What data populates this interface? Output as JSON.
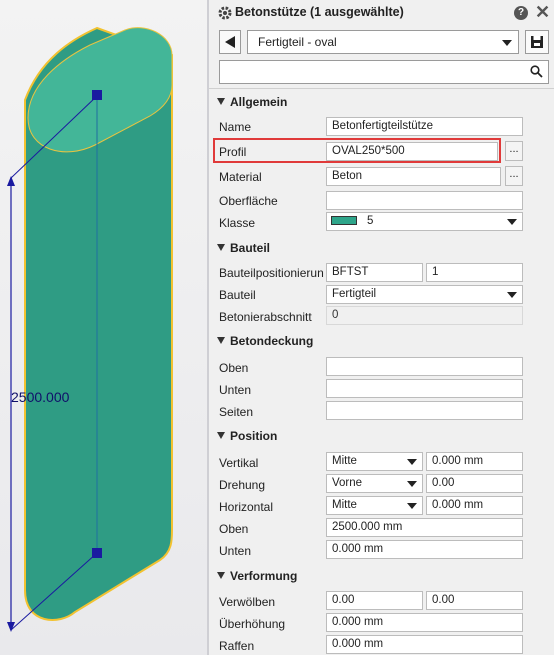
{
  "viewport": {
    "dimension_label": "2500.000",
    "colors": {
      "body": "#2f9c84",
      "top": "#42b597",
      "outline": "#f2c230",
      "dim": "#1a1aa0"
    }
  },
  "panel": {
    "title": "Betonstütze (1 ausgewählte)",
    "help_icon": "?",
    "close_icon": "✕",
    "preset": "Fertigteil - oval",
    "search_placeholder": "",
    "dots": "..."
  },
  "sections": {
    "allgemein": "Allgemein",
    "bauteil": "Bauteil",
    "betondeckung": "Betondeckung",
    "position": "Position",
    "verformung": "Verformung"
  },
  "allgemein": {
    "name_label": "Name",
    "name_value": "Betonfertigteilstütze",
    "profil_label": "Profil",
    "profil_value": "OVAL250*500",
    "material_label": "Material",
    "material_value": "Beton",
    "oberflaeche_label": "Oberfläche",
    "oberflaeche_value": "",
    "klasse_label": "Klasse",
    "klasse_value": "5",
    "klasse_color": "#2ea58a"
  },
  "bauteil": {
    "pos_label": "Bauteilpositionierun",
    "pos_prefix": "BFTST",
    "pos_number": "1",
    "bauteil_label": "Bauteil",
    "bauteil_value": "Fertigteil",
    "abschnitt_label": "Betonierabschnitt",
    "abschnitt_value": "0"
  },
  "betondeckung": {
    "oben_label": "Oben",
    "oben_value": "",
    "unten_label": "Unten",
    "unten_value": "",
    "seiten_label": "Seiten",
    "seiten_value": ""
  },
  "position": {
    "vertikal_label": "Vertikal",
    "vertikal_mode": "Mitte",
    "vertikal_value": "0.000 mm",
    "drehung_label": "Drehung",
    "drehung_mode": "Vorne",
    "drehung_value": "0.00",
    "horizontal_label": "Horizontal",
    "horizontal_mode": "Mitte",
    "horizontal_value": "0.000 mm",
    "oben_label": "Oben",
    "oben_value": "2500.000 mm",
    "unten_label": "Unten",
    "unten_value": "0.000 mm"
  },
  "verformung": {
    "verwoelben_label": "Verwölben",
    "verwoelben_value1": "0.00",
    "verwoelben_value2": "0.00",
    "ueberhoehung_label": "Überhöhung",
    "ueberhoehung_value": "0.000 mm",
    "raffen_label": "Raffen",
    "raffen_value": "0.000 mm"
  }
}
